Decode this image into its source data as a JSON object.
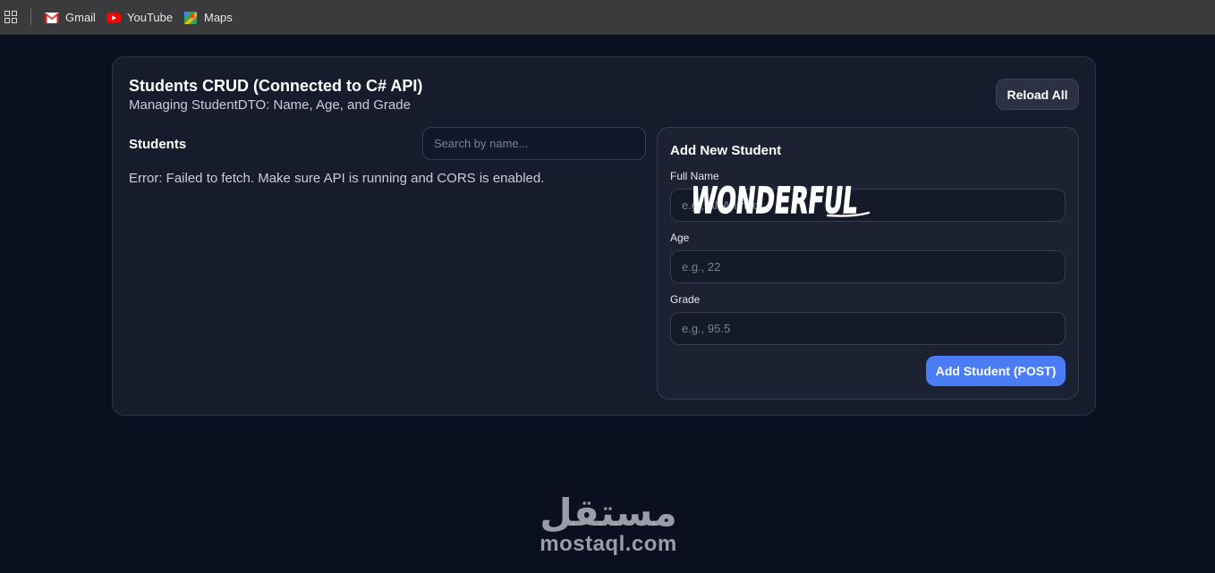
{
  "bookmarks": [
    {
      "label": "Gmail",
      "icon": "gmail-icon"
    },
    {
      "label": "YouTube",
      "icon": "youtube-icon"
    },
    {
      "label": "Maps",
      "icon": "maps-icon"
    }
  ],
  "header": {
    "title": "Students CRUD (Connected to C# API)",
    "subtitle": "Managing StudentDTO: Name, Age, and Grade",
    "reload_label": "Reload All"
  },
  "students": {
    "label": "Students",
    "search_placeholder": "Search by name...",
    "error": "Error: Failed to fetch. Make sure API is running and CORS is enabled."
  },
  "form": {
    "title": "Add New Student",
    "fields": [
      {
        "label": "Full Name",
        "placeholder": "e.g., Ali Ahmed"
      },
      {
        "label": "Age",
        "placeholder": "e.g., 22"
      },
      {
        "label": "Grade",
        "placeholder": "e.g., 95.5"
      }
    ],
    "submit_label": "Add Student (POST)",
    "overlay_text": "WONDERFUL"
  },
  "watermark": {
    "arabic": "مستقل",
    "text": "mostaql.com"
  },
  "colors": {
    "background": "#0b1020",
    "card": "#161c2c",
    "panel": "#1d2233",
    "accent": "#4a7cf5"
  }
}
